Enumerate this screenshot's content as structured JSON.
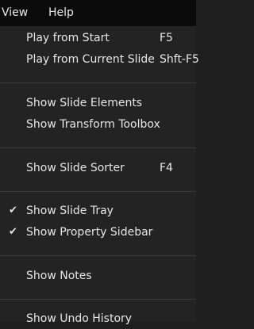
{
  "menubar": {
    "items": [
      {
        "label": "View"
      },
      {
        "label": "Help"
      }
    ]
  },
  "menu": {
    "items": [
      {
        "label": "Play from Start",
        "shortcut": "F5",
        "checked": false
      },
      {
        "label": "Play from Current Slide",
        "shortcut": "Shft-F5",
        "checked": false
      },
      {
        "label": "Show Slide Elements",
        "shortcut": "",
        "checked": false
      },
      {
        "label": "Show Transform Toolbox",
        "shortcut": "",
        "checked": false
      },
      {
        "label": "Show Slide Sorter",
        "shortcut": "F4",
        "checked": false
      },
      {
        "label": "Show Slide Tray",
        "shortcut": "",
        "checked": true,
        "check_glyph": "✔"
      },
      {
        "label": "Show Property Sidebar",
        "shortcut": "",
        "checked": true,
        "check_glyph": "✔"
      },
      {
        "label": "Show Notes",
        "shortcut": "",
        "checked": false
      },
      {
        "label": "Show Undo History",
        "shortcut": "",
        "checked": false
      }
    ]
  },
  "colors": {
    "menubar_bg": "#0b0b0b",
    "menu_bg": "#232323",
    "text": "#e6e6e6",
    "separator": "#3a3a3a"
  }
}
